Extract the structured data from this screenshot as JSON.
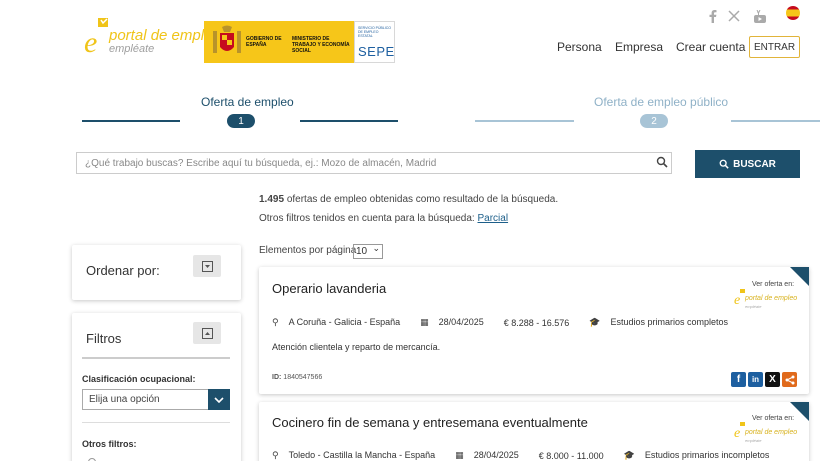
{
  "header": {
    "logo": {
      "title": "portal de empleo",
      "subtitle": "empléate"
    },
    "government": {
      "ministry_left": "GOBIERNO DE ESPAÑA",
      "ministry_right": "MINISTERIO DE TRABAJO Y ECONOMÍA SOCIAL",
      "sepe_small": "SERVICIO PÚBLICO DE EMPLEO ESTATAL",
      "sepe": "SEPE"
    },
    "social": [
      "facebook-icon",
      "x-twitter-icon",
      "youtube-icon"
    ],
    "nav": {
      "persona": "Persona",
      "empresa": "Empresa",
      "crear_cuenta": "Crear cuenta",
      "entrar": "ENTRAR"
    }
  },
  "steps": [
    {
      "label": "Oferta de empleo",
      "number": "1",
      "active": true
    },
    {
      "label": "Oferta de empleo público",
      "number": "2",
      "active": false
    }
  ],
  "search": {
    "placeholder": "¿Qué trabajo buscas? Escribe aquí tu búsqueda, ej.: Mozo de almacén, Madrid",
    "button": "BUSCAR"
  },
  "results": {
    "count": "1.495",
    "count_text": "ofertas de empleo obtenidas como resultado de la búsqueda.",
    "filters_text": "Otros filtros tenidos en cuenta para la búsqueda:",
    "filters_link": "Parcial",
    "per_page_label": "Elementos por página",
    "per_page_value": "10"
  },
  "sidebar": {
    "ordenar": "Ordenar por:",
    "filtros": "Filtros",
    "clasificacion_label": "Clasificación ocupacional:",
    "clasificacion_value": "Elija una opción",
    "otros_filtros": "Otros filtros:"
  },
  "jobs": [
    {
      "title": "Operario lavanderia",
      "location": "A Coruña - Galicia - España",
      "date": "28/04/2025",
      "salary": "€ 8.288 - 16.576",
      "studies": "Estudios primarios completos",
      "description": "Atención clientela y reparto de mercancía.",
      "id_label": "ID:",
      "id": "1840547566",
      "ver_oferta": "Ver oferta en:",
      "source_title": "portal de empleo",
      "source_sub": "empléate"
    },
    {
      "title": "Cocinero fin de semana y entresemana eventualmente",
      "location": "Toledo - Castilla la Mancha - España",
      "date": "28/04/2025",
      "salary": "€ 8.000 - 11.000",
      "studies": "Estudios primarios incompletos",
      "ver_oferta": "Ver oferta en:",
      "source_title": "portal de empleo",
      "source_sub": "empléate"
    }
  ],
  "share_icons": [
    "facebook-icon",
    "linkedin-icon",
    "x-twitter-icon",
    "share-icon"
  ],
  "colors": {
    "brand_dark": "#1d4f6b",
    "brand_yellow": "#f0c419",
    "link": "#1d5f8a"
  }
}
